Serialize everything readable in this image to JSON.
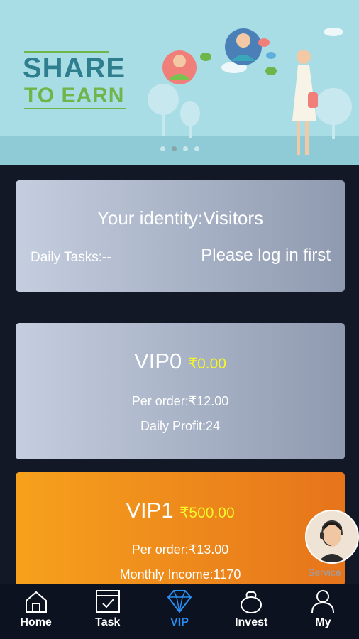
{
  "banner": {
    "title_line1": "SHARE",
    "title_line2": "TO EARN",
    "slide_count": 4,
    "active_slide": 2
  },
  "identity_card": {
    "identity_text": "Your identity:Visitors",
    "daily_tasks": "Daily Tasks:--",
    "login_prompt": "Please log in first"
  },
  "vip_cards": [
    {
      "level": "VIP0",
      "price": "₹0.00",
      "per_order": "Per order:₹12.00",
      "extra": "Daily Profit:24"
    },
    {
      "level": "VIP1",
      "price": "₹500.00",
      "per_order": "Per order:₹13.00",
      "extra": "Monthly Income:1170"
    }
  ],
  "service": {
    "label": "Service"
  },
  "nav": [
    {
      "label": "Home",
      "icon": "home-icon"
    },
    {
      "label": "Task",
      "icon": "task-icon"
    },
    {
      "label": "VIP",
      "icon": "diamond-icon",
      "active": true
    },
    {
      "label": "Invest",
      "icon": "money-bag-icon"
    },
    {
      "label": "My",
      "icon": "user-icon"
    }
  ],
  "colors": {
    "accent": "#2a8ef0",
    "price_yellow": "#f5f52a",
    "orange_card": "#f19a1c",
    "background": "#121826"
  }
}
